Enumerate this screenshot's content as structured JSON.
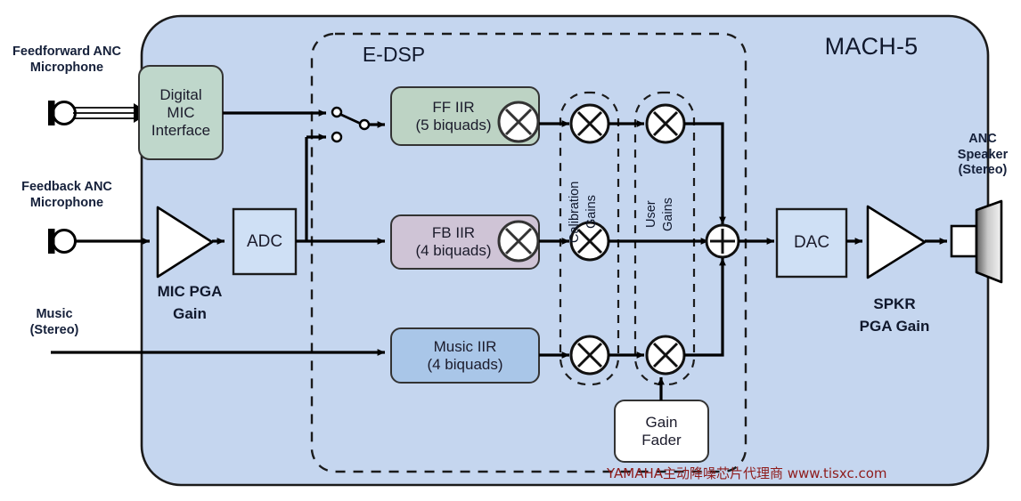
{
  "diagram": {
    "title": "MACH-5",
    "dsp_region_label": "E-DSP",
    "watermark": "YAMAHA主动降噪芯片代理商 www.tisxc.com"
  },
  "inputs": [
    {
      "id": "feedforward-mic",
      "label_line1": "Feedforward ANC",
      "label_line2": "Microphone",
      "icon": "microphone-icon",
      "connection": "digital-bus"
    },
    {
      "id": "feedback-mic",
      "label_line1": "Feedback ANC",
      "label_line2": "Microphone",
      "icon": "microphone-icon",
      "connection": "analog"
    },
    {
      "id": "music-input",
      "label_line1": "Music",
      "label_line2": "(Stereo)",
      "icon": "",
      "connection": "analog"
    }
  ],
  "outputs": [
    {
      "id": "anc-speaker",
      "label_line1": "ANC",
      "label_line2": "Speaker",
      "label_line3": "(Stereo)",
      "icon": "speaker-icon"
    }
  ],
  "blocks": [
    {
      "id": "digital-mic-interface",
      "line1": "Digital",
      "line2": "MIC",
      "line3": "Interface",
      "fill": "#bfd7cb"
    },
    {
      "id": "mic-pga",
      "label_line1": "MIC PGA",
      "label_line2": "Gain",
      "shape": "triangle-amplifier"
    },
    {
      "id": "adc",
      "label": "ADC",
      "fill": "#cfe0f5"
    },
    {
      "id": "ff-iir",
      "line1": "FF IIR",
      "line2": "(5 biquads)",
      "fill": "#bdd3c4"
    },
    {
      "id": "fb-iir",
      "line1": "FB IIR",
      "line2": "(4 biquads)",
      "fill": "#cfc4d6"
    },
    {
      "id": "music-iir",
      "line1": "Music IIR",
      "line2": "(4 biquads)",
      "fill": "#a9c6e8"
    },
    {
      "id": "gain-fader",
      "line1": "Gain",
      "line2": "Fader",
      "fill": "#ffffff"
    },
    {
      "id": "dac",
      "label": "DAC",
      "fill": "#cfe0f5"
    },
    {
      "id": "spkr-pga",
      "label_line1": "SPKR",
      "label_line2": "PGA Gain",
      "shape": "triangle-amplifier"
    }
  ],
  "gain_groups": [
    {
      "id": "calibration-gains",
      "line1": "Calibration",
      "line2": "Gains"
    },
    {
      "id": "user-gains",
      "line1": "User",
      "line2": "Gains"
    }
  ],
  "operators": {
    "multiply_symbol": "multiply-icon",
    "sum_symbol": "sum-icon",
    "switch_symbol": "spdt-switch-icon"
  },
  "colors": {
    "panel_fill": "#c5d6ef",
    "panel_stroke": "#1b1b1b",
    "ff_fill": "#bdd3c4",
    "fb_fill": "#cfc4d6",
    "music_fill": "#a9c6e8",
    "converter_fill": "#cfe0f5",
    "mic_interface_fill": "#bfd7cb",
    "line": "#000000",
    "watermark": "#8e1b1b",
    "text": "#1b1b2b"
  }
}
